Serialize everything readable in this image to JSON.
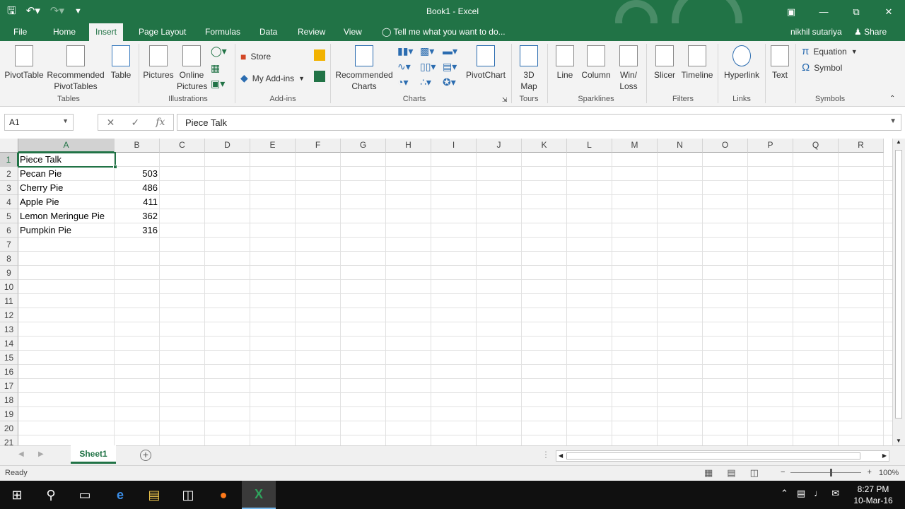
{
  "window": {
    "title": "Book1 - Excel"
  },
  "tabs": {
    "file": "File",
    "home": "Home",
    "insert": "Insert",
    "page_layout": "Page Layout",
    "formulas": "Formulas",
    "data": "Data",
    "review": "Review",
    "view": "View",
    "tell_me": "Tell me what you want to do...",
    "user": "nikhil sutariya",
    "share": "Share"
  },
  "ribbon": {
    "tables": {
      "label": "Tables",
      "pivottable": "PivotTable",
      "recommended_pivot": "Recommended PivotTables",
      "table": "Table"
    },
    "illustrations": {
      "label": "Illustrations",
      "pictures": "Pictures",
      "online_pictures": "Online Pictures"
    },
    "addins": {
      "label": "Add-ins",
      "store": "Store",
      "my_addins": "My Add-ins"
    },
    "charts": {
      "label": "Charts",
      "recommended_charts": "Recommended Charts",
      "pivotchart": "PivotChart"
    },
    "tours": {
      "label": "Tours",
      "map3d": "3D Map"
    },
    "sparklines": {
      "label": "Sparklines",
      "line": "Line",
      "column": "Column",
      "winloss": "Win/ Loss"
    },
    "filters": {
      "label": "Filters",
      "slicer": "Slicer",
      "timeline": "Timeline"
    },
    "links": {
      "label": "Links",
      "hyperlink": "Hyperlink"
    },
    "text": {
      "text": "Text"
    },
    "symbols": {
      "label": "Symbols",
      "equation": "Equation",
      "symbol": "Symbol"
    }
  },
  "formula_bar": {
    "name_box": "A1",
    "fx": "fx",
    "content": "Piece Talk"
  },
  "grid": {
    "columns": [
      "A",
      "B",
      "C",
      "D",
      "E",
      "F",
      "G",
      "H",
      "I",
      "J",
      "K",
      "L",
      "M",
      "N",
      "O",
      "P",
      "Q",
      "R"
    ],
    "rows": [
      "1",
      "2",
      "3",
      "4",
      "5",
      "6",
      "7",
      "8",
      "9",
      "10",
      "11",
      "12",
      "13",
      "14",
      "15",
      "16",
      "17",
      "18",
      "19",
      "20",
      "21"
    ],
    "cells": {
      "A1": "Piece Talk",
      "A2": "Pecan Pie",
      "B2": "503",
      "A3": "Cherry Pie",
      "B3": "486",
      "A4": "Apple Pie",
      "B4": "411",
      "A5": "Lemon Meringue Pie",
      "B5": "362",
      "A6": "Pumpkin Pie",
      "B6": "316"
    }
  },
  "sheets": {
    "active": "Sheet1"
  },
  "status": {
    "ready": "Ready",
    "zoom": "100%"
  },
  "taskbar": {
    "time": "8:27 PM",
    "date": "10-Mar-16"
  },
  "colors": {
    "accent": "#217346",
    "ribbon_bg": "#f3f3f3",
    "taskbar_bg": "#101010"
  }
}
